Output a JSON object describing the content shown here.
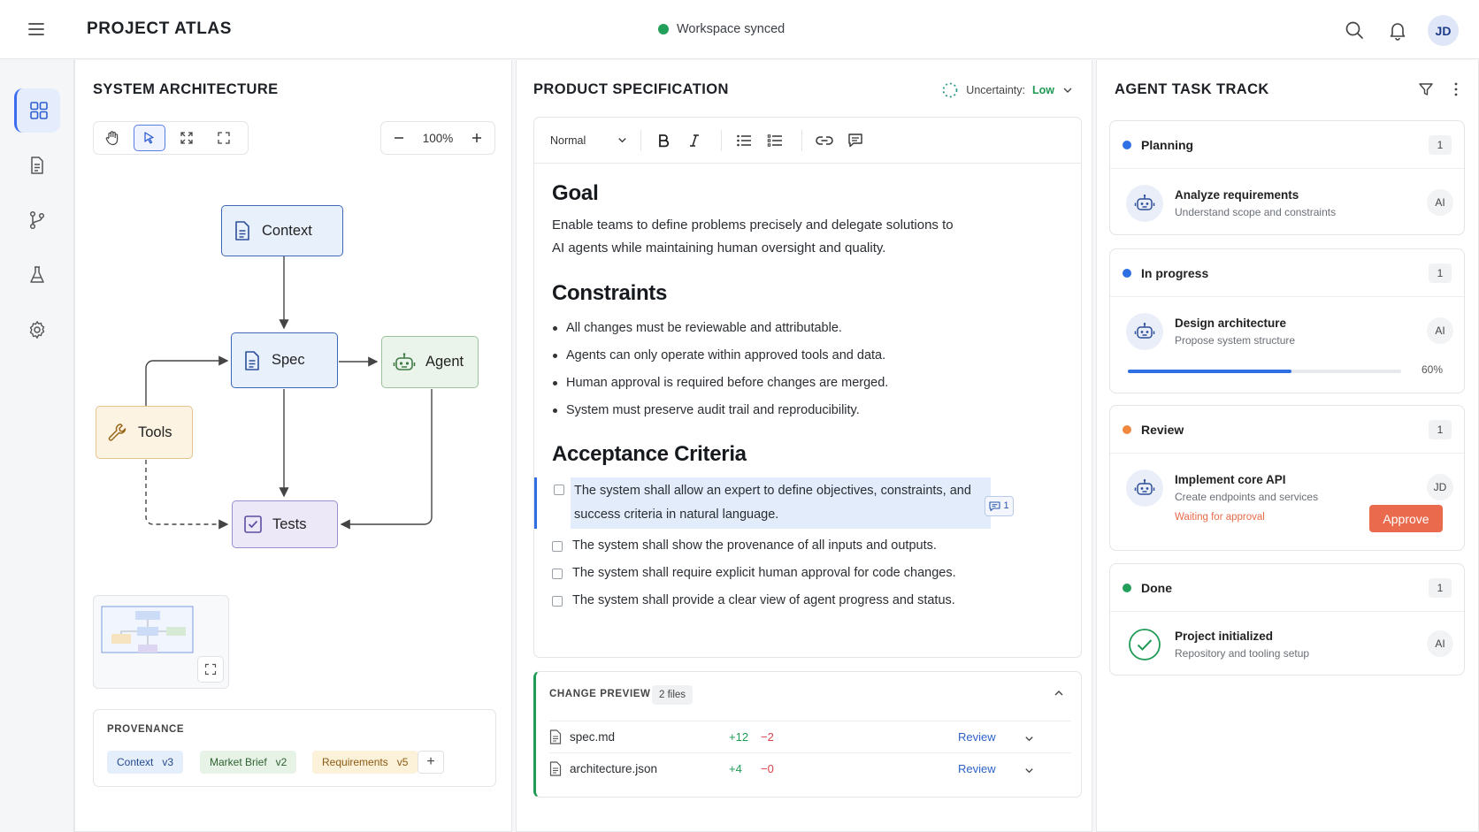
{
  "header": {
    "app_title": "PROJECT ATLAS",
    "sync_status": "Workspace synced",
    "user_initials": "JD"
  },
  "rail": {
    "items": [
      "grid-icon",
      "document-icon",
      "branch-icon",
      "flask-icon",
      "settings-icon"
    ],
    "active": "grid-icon"
  },
  "architecture": {
    "title": "SYSTEM ARCHITECTURE",
    "zoom": "100%",
    "nodes": {
      "context": "Context",
      "spec": "Spec",
      "agent": "Agent",
      "tools": "Tools",
      "tests": "Tests"
    },
    "provenance": {
      "title": "PROVENANCE",
      "chips": [
        "Context   v3",
        "Market Brief   v2",
        "Requirements   v5"
      ],
      "add_label": "+"
    }
  },
  "spec": {
    "title": "PRODUCT SPECIFICATION",
    "uncertainty_label": "Uncertainty:",
    "uncertainty_value": "Low",
    "format": "Normal",
    "goal_heading": "Goal",
    "goal_text": "Enable teams to define problems precisely and delegate solutions to AI agents while maintaining human oversight and quality.",
    "constraints_heading": "Constraints",
    "constraints": [
      "All changes must be reviewable and attributable.",
      "Agents can only operate within approved tools and data.",
      "Human approval is required before changes are merged.",
      "System must preserve audit trail and reproducibility."
    ],
    "criteria_heading": "Acceptance Criteria",
    "criteria": [
      "The system shall allow an expert to define objectives, constraints, and success criteria in natural language.",
      "The system shall show the provenance of all inputs and outputs.",
      "The system shall require explicit human approval for code changes.",
      "The system shall provide a clear view of agent progress and status."
    ],
    "comment_count": "1",
    "changes": {
      "title": "CHANGE PREVIEW",
      "count": "2 files",
      "files": [
        {
          "name": "spec.md",
          "add": "+12",
          "del": "−2",
          "action": "Review"
        },
        {
          "name": "architecture.json",
          "add": "+4",
          "del": "−0",
          "action": "Review"
        }
      ]
    }
  },
  "tasks": {
    "title": "AGENT TASK TRACK",
    "columns": [
      {
        "name": "Planning",
        "count": "1",
        "color": "#2f6fe4",
        "task": {
          "title": "Analyze requirements",
          "sub": "Understand scope and constraints",
          "owner": "AI"
        }
      },
      {
        "name": "In progress",
        "count": "1",
        "color": "#2f6fe4",
        "task": {
          "title": "Design architecture",
          "sub": "Propose system structure",
          "owner": "AI",
          "progress": 0.6,
          "progress_label": "60%"
        }
      },
      {
        "name": "Review",
        "count": "1",
        "color": "#f0883e",
        "task": {
          "title": "Implement core API",
          "sub": "Create endpoints and services",
          "owner": "JD",
          "waiting": "Waiting for approval",
          "action": "Approve"
        }
      },
      {
        "name": "Done",
        "count": "1",
        "color": "#22a05b",
        "task": {
          "title": "Project initialized",
          "sub": "Repository and tooling setup",
          "owner": "AI"
        }
      }
    ]
  }
}
